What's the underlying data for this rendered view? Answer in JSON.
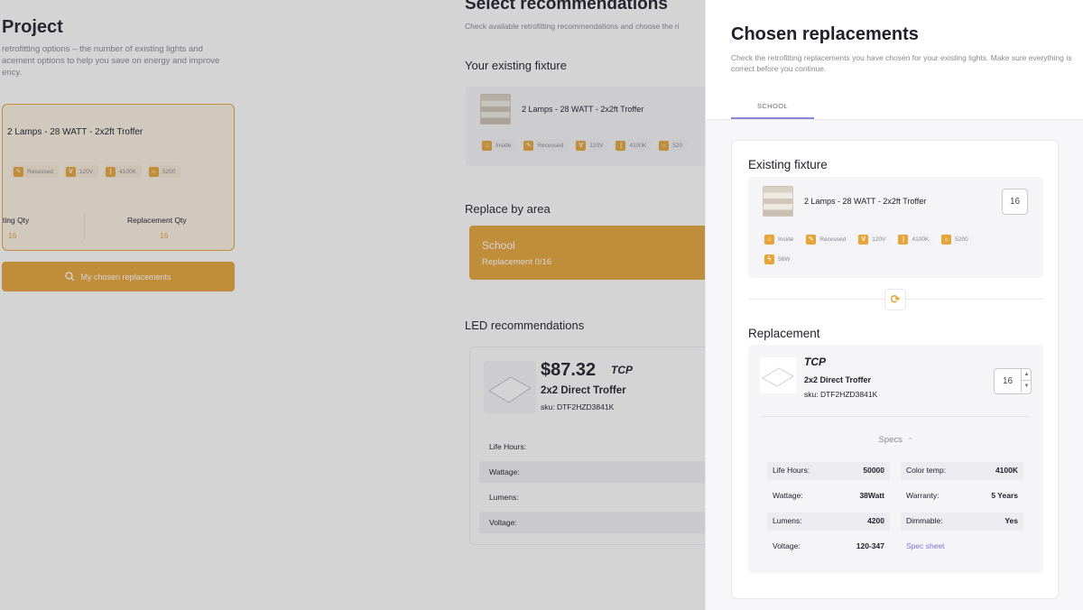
{
  "background": {
    "project_title": "Project",
    "project_subtitle": "retrofitting options – the number of existing lights and acement options to help you save on energy and improve ency.",
    "selected_card": {
      "title": "2 Lamps - 28 WATT - 2x2ft Troffer",
      "chips": [
        "Recessed",
        "120V",
        "4100K",
        "5200"
      ],
      "existing_qty_label": "ting Qty",
      "existing_qty_value": "16",
      "replacement_qty_label": "Replacement Qty",
      "replacement_qty_value": "16"
    },
    "chosen_button_label": "My chosen replacements",
    "select_title": "Select recommendations",
    "select_subtitle": "Check available retrofitting recommendations and choose the ri",
    "existing_fixture_heading": "Your existing fixture",
    "existing_fixture_name": "2 Lamps - 28 WATT - 2x2ft Troffer",
    "existing_fixture_chips": [
      "Inside",
      "Recessed",
      "120V",
      "4100K",
      "520"
    ],
    "replace_by_area_heading": "Replace by area",
    "area": {
      "name": "School",
      "status": "Replacement 0/16"
    },
    "led_heading": "LED recommendations",
    "led": {
      "price": "$87.32",
      "brand": "TCP",
      "name": "2x2 Direct Troffer",
      "sku": "sku: DTF2HZD3841K",
      "spec_labels": [
        "Life Hours:",
        "Wattage:",
        "Lumens:",
        "Voltage:"
      ]
    }
  },
  "drawer": {
    "title": "Chosen replacements",
    "subtitle": "Check the retrofitting replacements you have chosen for your existing lights. Make sure everything is correct before you continue.",
    "tab": "SCHOOL",
    "existing": {
      "heading": "Existing fixture",
      "name": "2 Lamps - 28 WATT - 2x2ft Troffer",
      "qty": "16",
      "chips": [
        {
          "icon": "house-icon",
          "glyph": "⌂",
          "label": "Inside"
        },
        {
          "icon": "wrench-icon",
          "glyph": "✎",
          "label": "Recessed"
        },
        {
          "icon": "voltage-icon",
          "glyph": "V",
          "label": "120V"
        },
        {
          "icon": "thermometer-icon",
          "glyph": "∣",
          "label": "4100K"
        },
        {
          "icon": "lumens-icon",
          "glyph": "☼",
          "label": "5200"
        },
        {
          "icon": "power-icon",
          "glyph": "ϟ",
          "label": "56W"
        }
      ]
    },
    "replacement": {
      "heading": "Replacement",
      "brand": "TCP",
      "name": "2x2 Direct Troffer",
      "sku": "sku: DTF2HZD3841K",
      "qty": "16",
      "specs_toggle": "Specs",
      "specs_left": [
        {
          "label": "Life Hours:",
          "value": "50000"
        },
        {
          "label": "Wattage:",
          "value": "38Watt"
        },
        {
          "label": "Lumens:",
          "value": "4200"
        },
        {
          "label": "Voltage:",
          "value": "120-347"
        }
      ],
      "specs_right": [
        {
          "label": "Color temp:",
          "value": "4100K"
        },
        {
          "label": "Warranty:",
          "value": "5 Years"
        },
        {
          "label": "Dimmable:",
          "value": "Yes"
        }
      ],
      "spec_sheet_link": "Spec sheet"
    }
  },
  "colors": {
    "accent": "#e6a43a",
    "link": "#7a73d6",
    "tab_underline": "#8a86d8"
  }
}
